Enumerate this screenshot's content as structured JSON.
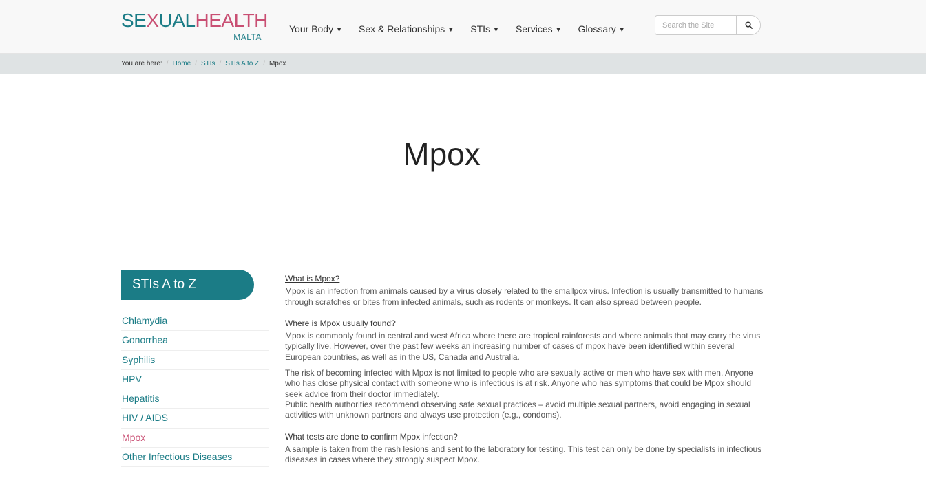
{
  "header": {
    "logo": {
      "part1": "SE",
      "part2": "X",
      "part3": "UAL",
      "part4": "HEALTH",
      "sub": "MALTA"
    },
    "nav": [
      {
        "label": "Your Body"
      },
      {
        "label": "Sex & Relationships"
      },
      {
        "label": "STIs"
      },
      {
        "label": "Services"
      },
      {
        "label": "Glossary"
      }
    ],
    "search": {
      "placeholder": "Search the Site",
      "icon": "search-icon"
    }
  },
  "breadcrumb": {
    "prefix": "You are here:",
    "items": [
      "Home",
      "STIs",
      "STIs A to Z"
    ],
    "current": "Mpox",
    "separator": "/"
  },
  "page": {
    "title": "Mpox"
  },
  "sidebar": {
    "title": "STIs A to Z",
    "items": [
      {
        "label": "Chlamydia"
      },
      {
        "label": "Gonorrhea"
      },
      {
        "label": "Syphilis"
      },
      {
        "label": "HPV"
      },
      {
        "label": "Hepatitis"
      },
      {
        "label": "HIV / AIDS"
      },
      {
        "label": "Mpox"
      },
      {
        "label": "Other Infectious Diseases"
      }
    ]
  },
  "content": {
    "s1": {
      "heading": "What is Mpox?",
      "text": "Mpox is an infection from animals caused by a virus closely related to the smallpox virus. Infection is usually transmitted to humans through scratches or bites from infected animals, such as rodents or monkeys. It can also spread between people."
    },
    "s2": {
      "heading": "Where is Mpox usually found?",
      "text": "Mpox is commonly found in central and west Africa where there are tropical rainforests and where animals that may carry the virus typically live. However, over the past few weeks an increasing number of cases of mpox have been identified within several European countries, as well as in the US, Canada and Australia."
    },
    "s3": {
      "text1": "The risk of becoming infected with Mpox is not limited to people who are sexually active or men who have sex with men. Anyone who has close physical contact with someone who is infectious is at risk. Anyone who has symptoms that could be Mpox should seek advice from their doctor immediately.",
      "text2": "Public health authorities recommend observing safe sexual practices – avoid multiple sexual partners, avoid engaging in sexual activities with unknown partners and always use protection (e.g., condoms)."
    },
    "s4": {
      "heading": "What tests are done to confirm Mpox infection?",
      "text": "A sample is taken from the rash lesions and sent to the laboratory for testing.  This test can only be done by specialists in infectious diseases in cases where they strongly suspect Mpox."
    }
  },
  "colors": {
    "teal": "#1b7c86",
    "pink": "#c94f73"
  }
}
